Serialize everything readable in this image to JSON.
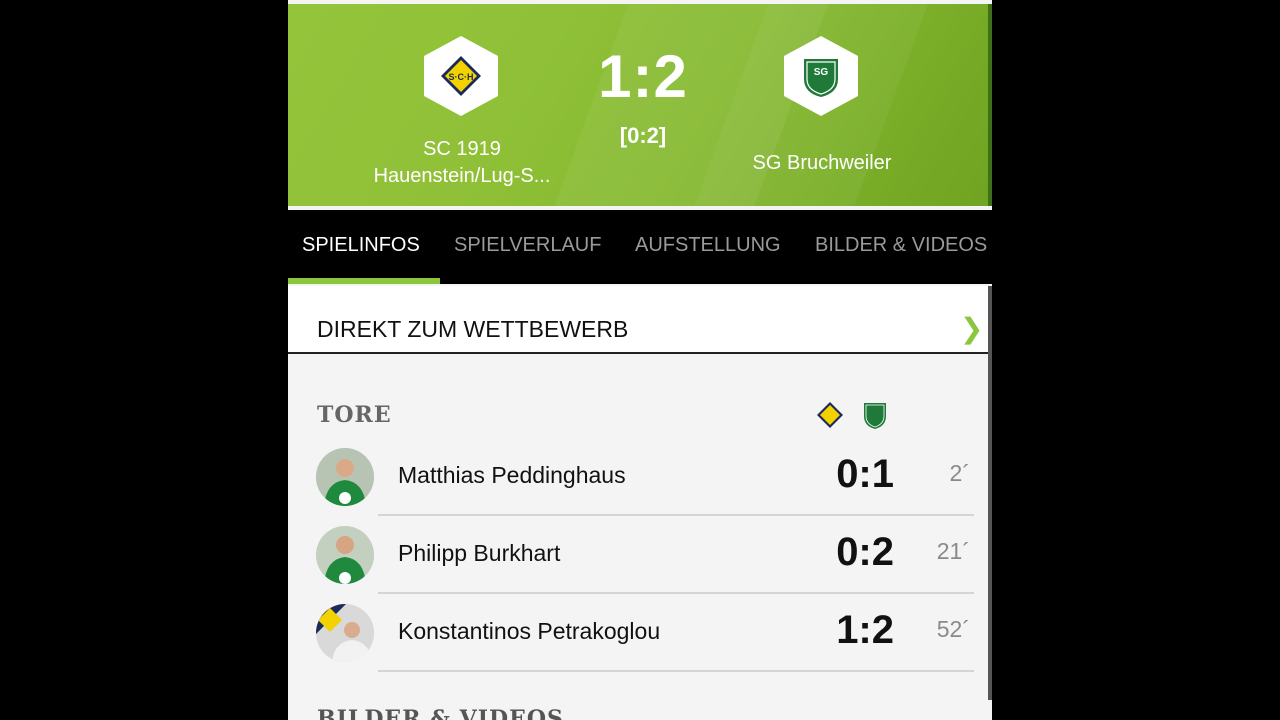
{
  "match": {
    "home_team": "SC 1919 Hauenstein/Lug-S...",
    "away_team": "SG Bruchweiler",
    "score": "1:2",
    "halftime": "[0:2]",
    "home_logo_text": "S·C·H",
    "away_logo_text": "SG"
  },
  "tabs": [
    {
      "label": "SPIELINFOS",
      "active": true
    },
    {
      "label": "SPIELVERLAUF",
      "active": false
    },
    {
      "label": "AUFSTELLUNG",
      "active": false
    },
    {
      "label": "BILDER & VIDEOS",
      "active": false
    }
  ],
  "competition_link": {
    "label": "DIREKT ZUM WETTBEWERB",
    "icon": "chevron-right-icon"
  },
  "goals": {
    "title": "TORE",
    "rows": [
      {
        "player": "Matthias Peddinghaus",
        "score": "0:1",
        "minute": "2´"
      },
      {
        "player": "Philipp Burkhart",
        "score": "0:2",
        "minute": "21´"
      },
      {
        "player": "Konstantinos Petrakoglou",
        "score": "1:2",
        "minute": "52´"
      }
    ]
  },
  "next_section": {
    "title": "BILDER & VIDEOS"
  },
  "colors": {
    "accent": "#8cc63f",
    "header_green": "#86b930",
    "away_green": "#1f7a3a",
    "home_yellow": "#f2d200",
    "home_navy": "#1c2a5a"
  }
}
